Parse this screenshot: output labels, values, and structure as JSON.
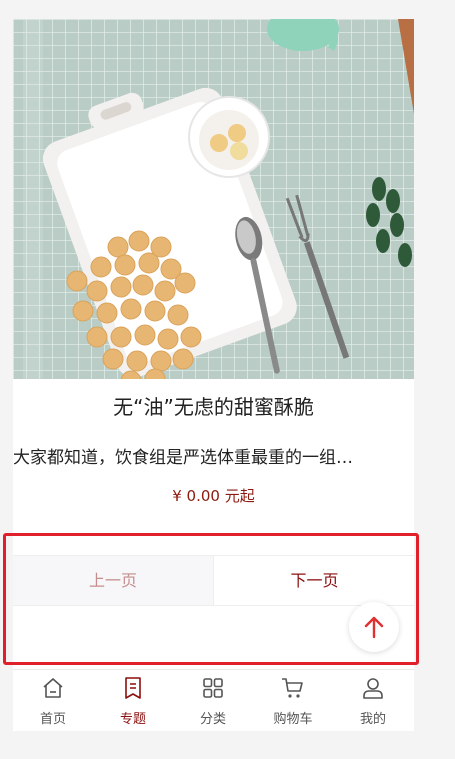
{
  "product": {
    "title": "无“油”无虑的甜蜜酥脆",
    "description": "大家都知道，饮食组是严选体重最重的一组…",
    "price": "¥  0.00 元起"
  },
  "pager": {
    "prev_label": "上一页",
    "next_label": "下一页"
  },
  "scroll_top": {
    "icon": "arrow-up-icon"
  },
  "tabbar": {
    "active": "专题",
    "items": [
      {
        "label": "首页",
        "icon": "home-icon"
      },
      {
        "label": "专题",
        "icon": "topic-icon"
      },
      {
        "label": "分类",
        "icon": "category-icon"
      },
      {
        "label": "购物车",
        "icon": "cart-icon"
      },
      {
        "label": "我的",
        "icon": "user-icon"
      }
    ]
  },
  "colors": {
    "accent": "#8b0f0f",
    "highlight": "#e0202a",
    "arrow": "#e03030"
  }
}
